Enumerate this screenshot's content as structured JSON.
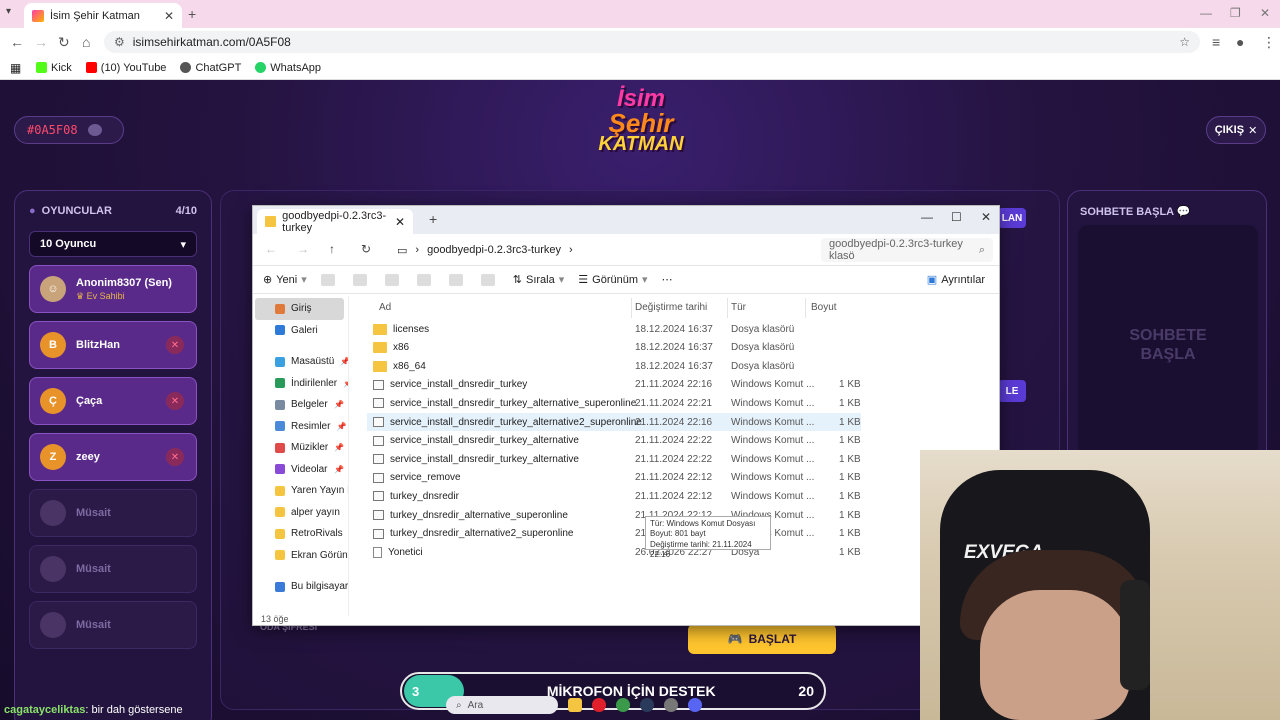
{
  "browser": {
    "tab_title": "İsim Şehir Katman",
    "url": "isimsehirkatman.com/0A5F08",
    "bookmarks": [
      "Kick",
      "(10) YouTube",
      "ChatGPT",
      "WhatsApp"
    ],
    "bookmark_colors": [
      "#53fc18",
      "#ff0000",
      "#555555",
      "#25d366"
    ]
  },
  "game": {
    "room_code": "#0A5F08",
    "logo": {
      "line1": "İsim",
      "line2": "Şehir",
      "line3": "KATMAN"
    },
    "exit_label": "ÇIKIŞ",
    "players_title": "OYUNCULAR",
    "players_count": "4/10",
    "player_count_select": "10 Oyuncu",
    "players": [
      {
        "initial": "",
        "name": "Anonim8307 (Sen)",
        "sub": "Ev Sahibi",
        "color": "#c9a37a"
      },
      {
        "initial": "B",
        "name": "BlitzHan",
        "sub": "",
        "color": "#e8922a"
      },
      {
        "initial": "Ç",
        "name": "Çaça",
        "sub": "",
        "color": "#e8922a"
      },
      {
        "initial": "Z",
        "name": "zeey",
        "sub": "",
        "color": "#e8922a"
      }
    ],
    "empty_slot_label": "Müsait",
    "chat_title": "SOHBETE BAŞLA",
    "chat_empty_line1": "SOHBETE",
    "chat_empty_line2": "BAŞLA",
    "pill_top": "LAN",
    "pill_mid": "LE",
    "oda_label": "ODA ŞİFRESİ",
    "start_label": "BAŞLAT",
    "ticker_left": "3",
    "ticker_label": "MİKROFON İÇİN DESTEK",
    "ticker_right": "20",
    "chat_user": "cagataycelikta s",
    "chat_user_display": "cagatayceliktas",
    "chat_message": ": bir dah göstersene"
  },
  "explorer": {
    "tab_title": "goodbyedpi-0.2.3rc3-turkey",
    "breadcrumb": "goodbyedpi-0.2.3rc3-turkey",
    "search_placeholder": "goodbyedpi-0.2.3rc3-turkey klasö",
    "cmd": {
      "new": "Yeni",
      "sort": "Sırala",
      "view": "Görünüm",
      "details": "Ayrıntılar"
    },
    "sidebar": [
      {
        "label": "Giriş",
        "color": "#e07a3a",
        "pinned": false
      },
      {
        "label": "Galeri",
        "color": "#2f7ad8",
        "pinned": false
      },
      {
        "label": "Masaüstü",
        "color": "#3aa0e0",
        "pinned": true
      },
      {
        "label": "İndirilenler",
        "color": "#2a9a5a",
        "pinned": true
      },
      {
        "label": "Belgeler",
        "color": "#7a8aa0",
        "pinned": true
      },
      {
        "label": "Resimler",
        "color": "#4a8ad8",
        "pinned": true
      },
      {
        "label": "Müzikler",
        "color": "#e04a4a",
        "pinned": true
      },
      {
        "label": "Videolar",
        "color": "#8a4ad8",
        "pinned": true
      },
      {
        "label": "Yaren Yayın Kur",
        "color": "#f5c542",
        "pinned": false
      },
      {
        "label": "alper yayın",
        "color": "#f5c542",
        "pinned": false
      },
      {
        "label": "RetroRivals",
        "color": "#f5c542",
        "pinned": false
      },
      {
        "label": "Ekran Görüntüle",
        "color": "#f5c542",
        "pinned": false
      },
      {
        "label": "Bu bilgisayar",
        "color": "#3a7ad8",
        "pinned": false
      }
    ],
    "columns": {
      "name": "Ad",
      "date": "Değiştirme tarihi",
      "type": "Tür",
      "size": "Boyut"
    },
    "rows": [
      {
        "name": "licenses",
        "date": "18.12.2024 16:37",
        "type": "Dosya klasörü",
        "size": "",
        "kind": "folder"
      },
      {
        "name": "x86",
        "date": "18.12.2024 16:37",
        "type": "Dosya klasörü",
        "size": "",
        "kind": "folder"
      },
      {
        "name": "x86_64",
        "date": "18.12.2024 16:37",
        "type": "Dosya klasörü",
        "size": "",
        "kind": "folder"
      },
      {
        "name": "service_install_dnsredir_turkey",
        "date": "21.11.2024 22:16",
        "type": "Windows Komut ...",
        "size": "1 KB",
        "kind": "cmd"
      },
      {
        "name": "service_install_dnsredir_turkey_alternative_superonline",
        "date": "21.11.2024 22:21",
        "type": "Windows Komut ...",
        "size": "1 KB",
        "kind": "cmd"
      },
      {
        "name": "service_install_dnsredir_turkey_alternative2_superonline",
        "date": "21.11.2024 22:16",
        "type": "Windows Komut ...",
        "size": "1 KB",
        "kind": "cmd"
      },
      {
        "name": "service_install_dnsredir_turkey_alternative",
        "date": "21.11.2024 22:22",
        "type": "Windows Komut ...",
        "size": "1 KB",
        "kind": "cmd"
      },
      {
        "name": "service_install_dnsredir_turkey_alternative",
        "date": "21.11.2024 22:22",
        "type": "Windows Komut ...",
        "size": "1 KB",
        "kind": "cmd"
      },
      {
        "name": "service_remove",
        "date": "21.11.2024 22:12",
        "type": "Windows Komut ...",
        "size": "1 KB",
        "kind": "cmd"
      },
      {
        "name": "turkey_dnsredir",
        "date": "21.11.2024 22:12",
        "type": "Windows Komut ...",
        "size": "1 KB",
        "kind": "cmd"
      },
      {
        "name": "turkey_dnsredir_alternative_superonline",
        "date": "21.11.2024 22:12",
        "type": "Windows Komut ...",
        "size": "1 KB",
        "kind": "cmd"
      },
      {
        "name": "turkey_dnsredir_alternative2_superonline",
        "date": "21.11.2024 22:12",
        "type": "Windows Komut ...",
        "size": "1 KB",
        "kind": "cmd"
      },
      {
        "name": "Yonetici",
        "date": "26.02.2026 22:27",
        "type": "Dosya",
        "size": "1 KB",
        "kind": "file"
      }
    ],
    "tooltip": {
      "line1": "Tür: Windows Komut Dosyası",
      "line2": "Boyut: 801 bayt",
      "line3": "Değiştirme tarihi: 21.11.2024 22:16"
    },
    "status": "13 öğe"
  },
  "webcam": {
    "chair_text": "EXVEGA"
  },
  "taskbar": {
    "search_placeholder": "Ara"
  }
}
